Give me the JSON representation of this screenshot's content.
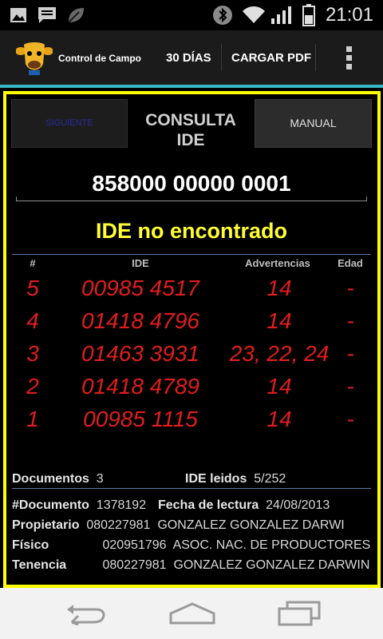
{
  "status_bar": {
    "time": "21:01",
    "icons": [
      "image-icon",
      "message-icon",
      "leaf-icon",
      "bluetooth-icon",
      "wifi-icon",
      "signal-icon",
      "battery-icon"
    ]
  },
  "action_bar": {
    "title": "Control de Campo",
    "btn_30dias": "30 DÍAS",
    "btn_cargar": "CARGAR PDF",
    "menu_icon": "overflow-menu-icon"
  },
  "tabs": {
    "left": "SIGUIENTE",
    "center_line1": "CONSULTA",
    "center_line2": "IDE",
    "right": "MANUAL"
  },
  "id_input": {
    "value": "858000 00000 0001"
  },
  "status_message": "IDE no encontrado",
  "table": {
    "headers": {
      "num": "#",
      "ide": "IDE",
      "advertencias": "Advertencias",
      "edad": "Edad"
    },
    "rows": [
      {
        "num": "5",
        "ide": "00985 4517",
        "adv": "14",
        "edad": "-"
      },
      {
        "num": "4",
        "ide": "01418 4796",
        "adv": "14",
        "edad": "-"
      },
      {
        "num": "3",
        "ide": "01463 3931",
        "adv": "23, 22, 24",
        "edad": "-"
      },
      {
        "num": "2",
        "ide": "01418 4789",
        "adv": "14",
        "edad": "-"
      },
      {
        "num": "1",
        "ide": "00985 1115",
        "adv": "14",
        "edad": "-"
      }
    ]
  },
  "summary": {
    "documentos_label": "Documentos",
    "documentos_value": "3",
    "ide_leidos_label": "IDE leidos",
    "ide_leidos_value": "5/252"
  },
  "details": {
    "documento_label": "#Documento",
    "documento_value": "1378192",
    "fecha_label": "Fecha de lectura",
    "fecha_value": "24/08/2013",
    "propietario_label": "Propietario",
    "propietario_id": "080227981",
    "propietario_name": "GONZALEZ GONZALEZ DARWI",
    "fisico_label": "Físico",
    "fisico_id": "020951796",
    "fisico_name": "ASOC. NAC. DE PRODUCTORES",
    "tenencia_label": "Tenencia",
    "tenencia_id": "080227981",
    "tenencia_name": "GONZALEZ GONZALEZ DARWIN"
  },
  "colors": {
    "accent_teal": "#34b5c3",
    "frame_yellow": "#ffff00",
    "row_red": "#e11d1d",
    "status_yellow": "#ffff33"
  }
}
